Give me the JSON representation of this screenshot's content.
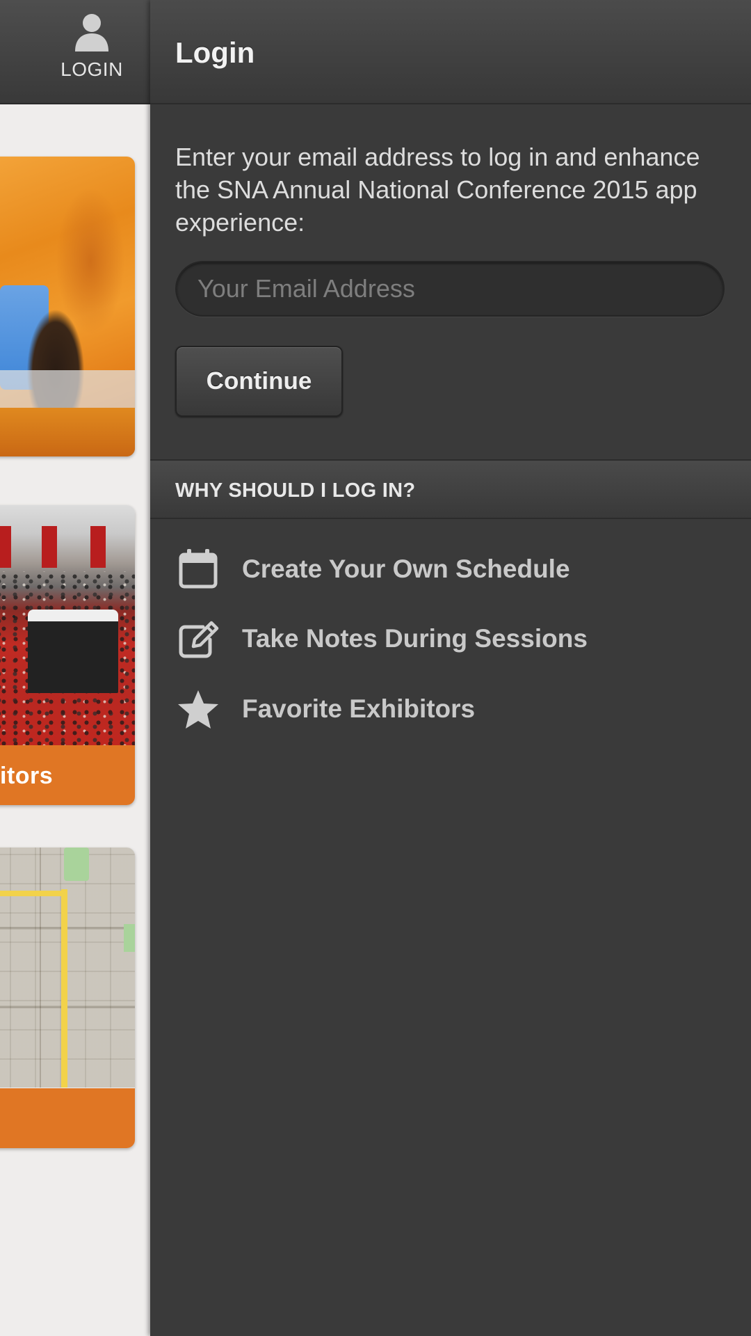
{
  "nav": {
    "login_label": "LOGIN",
    "login_icon": "user-icon"
  },
  "cards": [
    {
      "name": "canyon-photo-card",
      "label": ""
    },
    {
      "name": "exhibitors-card",
      "label": "itors"
    },
    {
      "name": "map-card",
      "label": ""
    }
  ],
  "login": {
    "title": "Login",
    "intro": "Enter your email address to log in and enhance the SNA Annual National Conference 2015 app experience:",
    "email_value": "",
    "email_placeholder": "Your Email Address",
    "continue_label": "Continue"
  },
  "why": {
    "title": "WHY SHOULD I LOG IN?",
    "benefits": [
      {
        "icon": "calendar-icon",
        "label": "Create Your Own Schedule"
      },
      {
        "icon": "edit-note-icon",
        "label": "Take Notes During Sessions"
      },
      {
        "icon": "star-icon",
        "label": "Favorite Exhibitors"
      }
    ]
  },
  "colors": {
    "panel_bg": "#3a3a3a",
    "card_accent": "#e07624",
    "left_bg": "#efedec",
    "text_light": "#dddddd"
  }
}
